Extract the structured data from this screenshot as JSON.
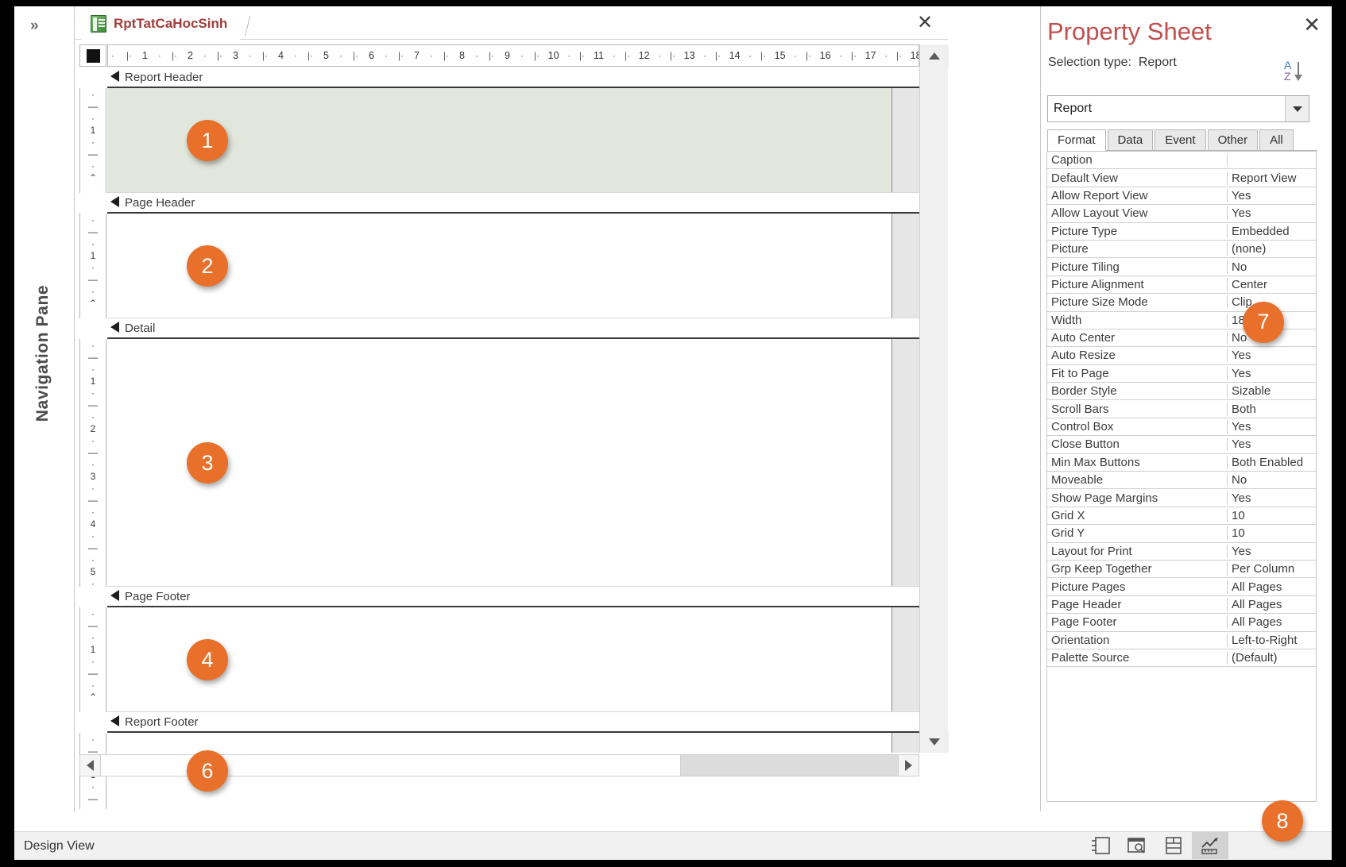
{
  "window": {
    "status_text": "Design View"
  },
  "navigation_pane": {
    "title": "Navigation Pane",
    "expand_chevron": "»",
    "icon": "double-chevron-right-icon"
  },
  "document": {
    "tab_label": "RptTatCaHocSinh",
    "tab_icon": "report-object-icon",
    "close_label": "✕",
    "horizontal_ruler": {
      "ticks": [
        "1",
        "2",
        "3",
        "4",
        "5",
        "6",
        "7",
        "8",
        "9",
        "10",
        "11",
        "12",
        "13",
        "14",
        "15",
        "16",
        "17",
        "18"
      ],
      "minor_mark": "'",
      "mid_mark": "I"
    },
    "vertical_rulers": [
      {
        "section": "report-header",
        "ticks": [
          "·",
          "—",
          "·",
          "1",
          "·",
          "—",
          "·",
          "⌃"
        ]
      },
      {
        "section": "page-header",
        "ticks": [
          "·",
          "—",
          "·",
          "1",
          "·",
          "—",
          "·",
          "⌃"
        ]
      },
      {
        "section": "detail",
        "ticks": [
          "·",
          "—",
          "·",
          "1",
          "·",
          "—",
          "·",
          "2",
          "·",
          "—",
          "·",
          "3",
          "·",
          "—",
          "·",
          "4",
          "·",
          "—",
          "·",
          "5",
          "·"
        ]
      },
      {
        "section": "page-footer",
        "ticks": [
          "·",
          "—",
          "·",
          "1",
          "·",
          "—",
          "·",
          "⌃"
        ]
      },
      {
        "section": "report-footer",
        "ticks": [
          "·",
          "—",
          "·",
          "1",
          "·",
          "—"
        ]
      }
    ],
    "sections": [
      {
        "id": "report-header",
        "label": "Report Header",
        "badge": "1",
        "shaded": true
      },
      {
        "id": "page-header",
        "label": "Page Header",
        "badge": "2",
        "shaded": false
      },
      {
        "id": "detail",
        "label": "Detail",
        "badge": "3",
        "shaded": false
      },
      {
        "id": "page-footer",
        "label": "Page Footer",
        "badge": "4",
        "shaded": false
      },
      {
        "id": "report-footer",
        "label": "Report Footer",
        "badge": "6",
        "shaded": false
      }
    ]
  },
  "property_sheet": {
    "title": "Property Sheet",
    "close_label": "✕",
    "selection_type_label": "Selection type:",
    "selection_type_value": "Report",
    "sort_icon": "sort-az-icon",
    "object_selector_value": "Report",
    "object_selector_icon": "chevron-down-icon",
    "tabs": [
      {
        "label": "Format",
        "active": true
      },
      {
        "label": "Data",
        "active": false
      },
      {
        "label": "Event",
        "active": false
      },
      {
        "label": "Other",
        "active": false
      },
      {
        "label": "All",
        "active": false
      }
    ],
    "badge_width_row": "7",
    "properties": [
      {
        "name": "Caption",
        "value": ""
      },
      {
        "name": "Default View",
        "value": "Report View"
      },
      {
        "name": "Allow Report View",
        "value": "Yes"
      },
      {
        "name": "Allow Layout View",
        "value": "Yes"
      },
      {
        "name": "Picture Type",
        "value": "Embedded"
      },
      {
        "name": "Picture",
        "value": "(none)"
      },
      {
        "name": "Picture Tiling",
        "value": "No"
      },
      {
        "name": "Picture Alignment",
        "value": "Center"
      },
      {
        "name": "Picture Size Mode",
        "value": "Clip"
      },
      {
        "name": "Width",
        "value": "18cm"
      },
      {
        "name": "Auto Center",
        "value": "No"
      },
      {
        "name": "Auto Resize",
        "value": "Yes"
      },
      {
        "name": "Fit to Page",
        "value": "Yes"
      },
      {
        "name": "Border Style",
        "value": "Sizable"
      },
      {
        "name": "Scroll Bars",
        "value": "Both"
      },
      {
        "name": "Control Box",
        "value": "Yes"
      },
      {
        "name": "Close Button",
        "value": "Yes"
      },
      {
        "name": "Min Max Buttons",
        "value": "Both Enabled"
      },
      {
        "name": "Moveable",
        "value": "No"
      },
      {
        "name": "Show Page Margins",
        "value": "Yes"
      },
      {
        "name": "Grid X",
        "value": "10"
      },
      {
        "name": "Grid Y",
        "value": "10"
      },
      {
        "name": "Layout for Print",
        "value": "Yes"
      },
      {
        "name": "Grp Keep Together",
        "value": "Per Column"
      },
      {
        "name": "Picture Pages",
        "value": "All Pages"
      },
      {
        "name": "Page Header",
        "value": "All Pages"
      },
      {
        "name": "Page Footer",
        "value": "All Pages"
      },
      {
        "name": "Orientation",
        "value": "Left-to-Right"
      },
      {
        "name": "Palette Source",
        "value": "(Default)"
      }
    ]
  },
  "view_buttons": {
    "badge": "8",
    "items": [
      {
        "icon": "report-view-icon",
        "active": false
      },
      {
        "icon": "print-preview-icon",
        "active": false
      },
      {
        "icon": "layout-view-icon",
        "active": false
      },
      {
        "icon": "design-view-icon",
        "active": true
      }
    ]
  },
  "colors": {
    "accent_badge": "#e8702a",
    "property_sheet_title": "#c0504d",
    "tab_label": "#a23c3c",
    "report_header_band": "#e2e7dd"
  }
}
